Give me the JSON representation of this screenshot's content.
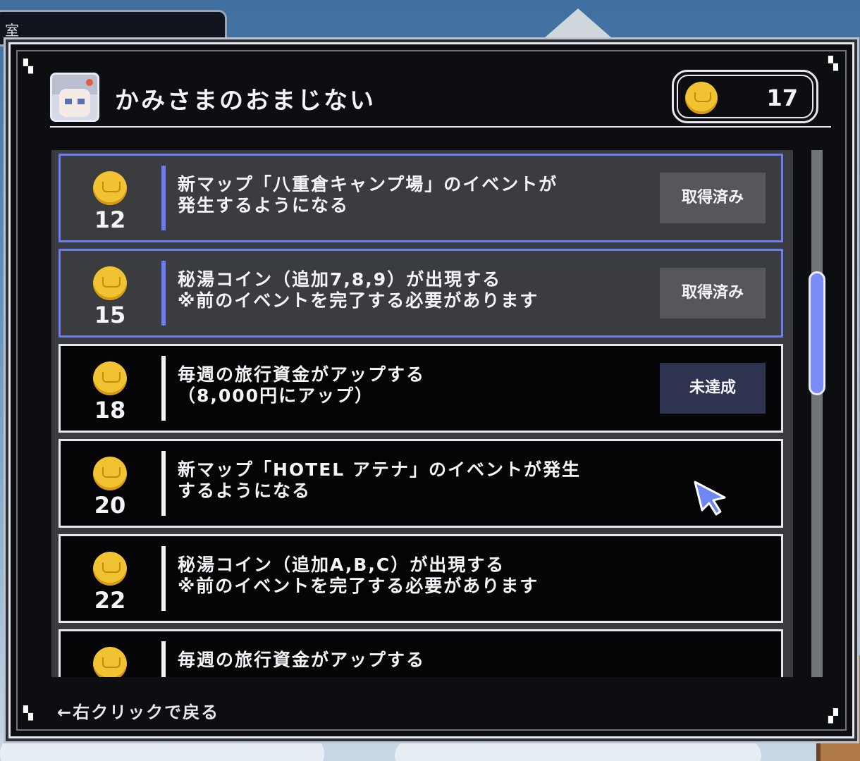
{
  "background": {
    "panel_text": "室"
  },
  "dialog": {
    "title": "かみさまのおまじない",
    "coin_count": "17",
    "back_hint": "←右クリックで戻る"
  },
  "rewards": [
    {
      "cost": "12",
      "description": "新マップ「八重倉キャンプ場」のイベントが\n発生するようになる",
      "status": "取得済み",
      "state": "acquired"
    },
    {
      "cost": "15",
      "description": "秘湯コイン（追加7,8,9）が出現する\n※前のイベントを完了する必要があります",
      "status": "取得済み",
      "state": "acquired"
    },
    {
      "cost": "18",
      "description": "毎週の旅行資金がアップする\n（8,000円にアップ）",
      "status": "未達成",
      "state": "unmet"
    },
    {
      "cost": "20",
      "description": "新マップ「HOTEL アテナ」のイベントが発生\nするようになる",
      "status": "",
      "state": "none"
    },
    {
      "cost": "22",
      "description": "秘湯コイン（追加A,B,C）が出現する\n※前のイベントを完了する必要があります",
      "status": "",
      "state": "none"
    },
    {
      "cost": "",
      "description": "毎週の旅行資金がアップする",
      "status": "",
      "state": "none"
    }
  ],
  "colors": {
    "accent": "#6c7cf2",
    "coin": "#f1c232",
    "panel": "#0d0e12"
  },
  "scroll": {
    "position_fraction": 0.3
  }
}
